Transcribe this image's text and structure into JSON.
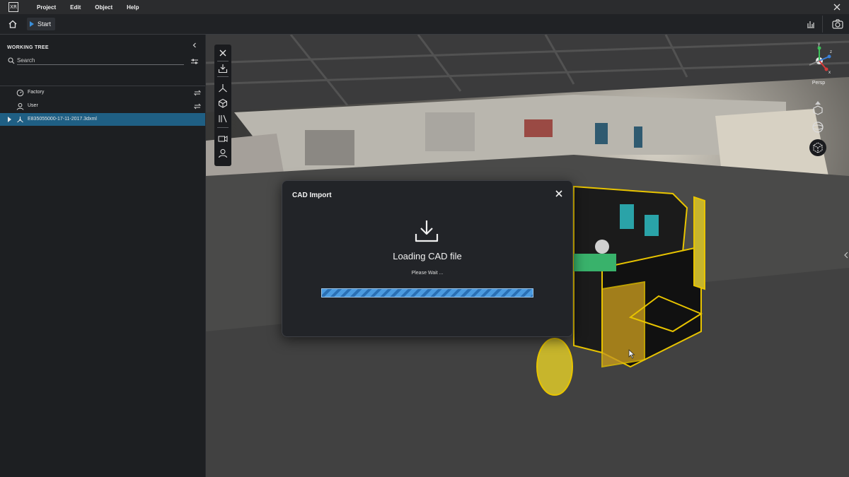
{
  "menu": {
    "logo_text": "XR",
    "items": [
      "Project",
      "Edit",
      "Object",
      "Help"
    ]
  },
  "toolbar": {
    "start_label": "Start"
  },
  "sidebar": {
    "title": "WORKING TREE",
    "search_placeholder": "Search",
    "items": [
      {
        "label": "Factory",
        "icon": "gauge-icon",
        "selected": false
      },
      {
        "label": "User",
        "icon": "user-icon",
        "selected": false
      },
      {
        "label": "E835055000-17-11-2017.3dxml",
        "icon": "assembly-icon",
        "selected": true
      }
    ]
  },
  "viewport": {
    "view_mode": "Persp",
    "gizmo_axes": [
      "y",
      "z",
      "x"
    ],
    "tools": [
      "close-icon",
      "import-icon",
      "axes-icon",
      "cube-icon",
      "library-icon",
      "camera-icon",
      "user-icon"
    ]
  },
  "dialog": {
    "title": "CAD Import",
    "message": "Loading CAD file",
    "sub_message": "Please Wait ...",
    "progress": 1.0
  },
  "colors": {
    "accent": "#1f5f84",
    "progress": "#4b9be0",
    "model_outline": "#e8c400"
  }
}
